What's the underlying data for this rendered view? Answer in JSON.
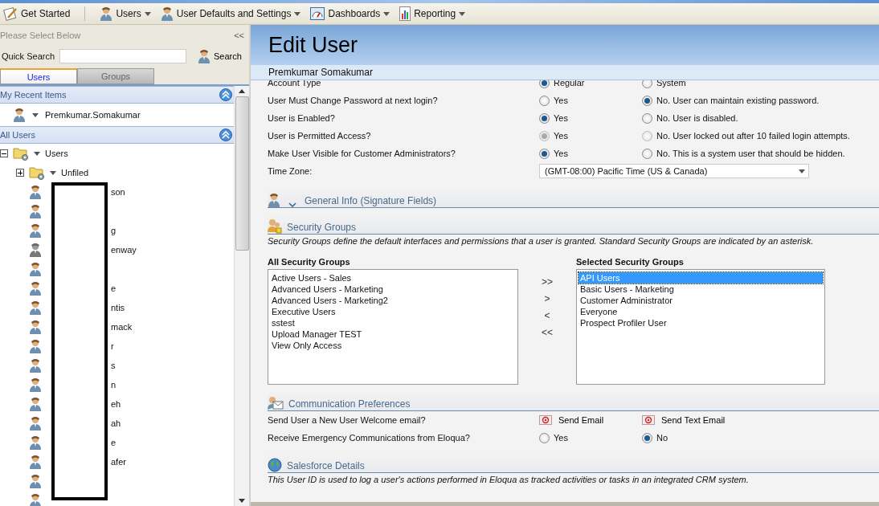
{
  "toolbar": {
    "items": [
      {
        "label": "Get Started",
        "kind": "start"
      },
      {
        "label": "Users",
        "kind": "user"
      },
      {
        "label": "User Defaults and Settings",
        "kind": "user"
      },
      {
        "label": "Dashboards",
        "kind": "dashboard"
      },
      {
        "label": "Reporting",
        "kind": "report"
      }
    ]
  },
  "sidebar": {
    "header": "Please Select Below",
    "collapse": "<<",
    "quick_search": {
      "label": "Quick Search",
      "button": "Search"
    },
    "tabs": [
      {
        "label": "Users",
        "selected": true
      },
      {
        "label": "Groups",
        "selected": false
      }
    ],
    "recent": {
      "title": "My Recent Items",
      "items": [
        "Premkumar.Somakumar"
      ]
    },
    "all_users": {
      "title": "All Users",
      "tree": [
        {
          "label": "Users",
          "kind": "folder",
          "expanded": true,
          "children": [
            {
              "label": "Unfiled",
              "kind": "folder",
              "expanded": false
            },
            {
              "label": "son",
              "kind": "user",
              "disabled": false
            },
            {
              "kind": "user",
              "disabled": false
            },
            {
              "label": "g",
              "kind": "user",
              "disabled": false
            },
            {
              "label": "enway",
              "kind": "user",
              "disabled": true
            },
            {
              "kind": "user",
              "disabled": false
            },
            {
              "label": "e",
              "kind": "user",
              "disabled": false
            },
            {
              "label": "ntis",
              "kind": "user",
              "disabled": false
            },
            {
              "label": "mack",
              "kind": "user",
              "disabled": false
            },
            {
              "label": "r",
              "kind": "user",
              "disabled": false
            },
            {
              "label": "s",
              "kind": "user",
              "disabled": false
            },
            {
              "label": "n",
              "kind": "user",
              "disabled": false
            },
            {
              "label": "eh",
              "kind": "user",
              "disabled": false
            },
            {
              "label": "ah",
              "kind": "user",
              "disabled": false
            },
            {
              "label": "e",
              "kind": "user",
              "disabled": false
            },
            {
              "label": "afer",
              "kind": "user",
              "disabled": false
            },
            {
              "kind": "user",
              "disabled": false
            },
            {
              "kind": "user",
              "disabled": false
            }
          ]
        }
      ]
    }
  },
  "main": {
    "title": "Edit User",
    "user_name": "Premkumar Somakumar",
    "options": [
      {
        "label": "Account Type",
        "disabled": false,
        "choices": [
          {
            "label": "Regular",
            "selected": true
          },
          {
            "label": "System",
            "selected": false
          }
        ]
      },
      {
        "label": "User Must Change Password at next login?",
        "disabled": false,
        "choices": [
          {
            "label": "Yes",
            "selected": false
          },
          {
            "label": "No. User can maintain existing password.",
            "selected": true
          }
        ]
      },
      {
        "label": "User is Enabled?",
        "disabled": false,
        "choices": [
          {
            "label": "Yes",
            "selected": true
          },
          {
            "label": "No. User is disabled.",
            "selected": false
          }
        ]
      },
      {
        "label": "User is Permitted Access?",
        "disabled": true,
        "choices": [
          {
            "label": "Yes",
            "selected": true
          },
          {
            "label": "No. User locked out after 10 failed login attempts.",
            "selected": false
          }
        ]
      },
      {
        "label": "Make User Visible for Customer Administrators?",
        "disabled": false,
        "choices": [
          {
            "label": "Yes",
            "selected": true
          },
          {
            "label": "No. This is a system user that should be hidden.",
            "selected": false
          }
        ]
      }
    ],
    "time_zone": {
      "label": "Time Zone:",
      "value": "(GMT-08:00) Pacific Time (US & Canada)"
    },
    "general_info": {
      "title": "General Info (Signature Fields)",
      "expanded": false
    },
    "security_groups": {
      "title": "Security Groups",
      "description": "Security Groups define the default interfaces and permissions that a user is granted. Standard Security Groups are indicated by an asterisk.",
      "all": {
        "title": "All Security Groups",
        "items": [
          {
            "label": "Active Users - Sales",
            "selected": false
          },
          {
            "label": "Advanced Users - Marketing",
            "selected": false
          },
          {
            "label": "Advanced Users - Marketing2",
            "selected": false
          },
          {
            "label": "Executive Users",
            "selected": false
          },
          {
            "label": "sstest",
            "selected": false
          },
          {
            "label": "Upload Manager TEST",
            "selected": false
          },
          {
            "label": "View Only Access",
            "selected": false
          }
        ]
      },
      "move_buttons": [
        ">>",
        ">",
        "<",
        "<<"
      ],
      "chosen": {
        "title": "Selected Security Groups",
        "items": [
          {
            "label": "API Users",
            "selected": true
          },
          {
            "label": "Basic Users - Marketing",
            "selected": false
          },
          {
            "label": "Customer Administrator",
            "selected": false
          },
          {
            "label": "Everyone",
            "selected": false
          },
          {
            "label": "Prospect Profiler User",
            "selected": false
          }
        ]
      }
    },
    "communication": {
      "title": "Communication Preferences",
      "rows": [
        {
          "label": "Send User a New User Welcome email?",
          "kind": "actions",
          "actions": [
            "Send Email",
            "Send Text Email"
          ]
        },
        {
          "label": "Receive Emergency Communications from Eloqua?",
          "kind": "radio",
          "choices": [
            {
              "label": "Yes",
              "selected": false
            },
            {
              "label": "No",
              "selected": true
            }
          ]
        }
      ]
    },
    "salesforce": {
      "title": "Salesforce Details",
      "description": "This User ID is used to log a user's actions performed in Eloqua as tracked activities or tasks in an integrated CRM system."
    }
  }
}
